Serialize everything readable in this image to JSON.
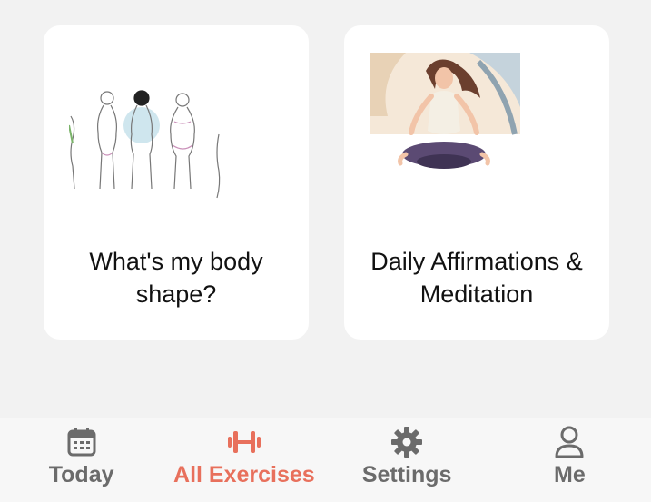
{
  "cards": [
    {
      "title": "What's my body shape?",
      "image": "body-shapes-illustration"
    },
    {
      "title": "Daily Affirmations & Meditation",
      "image": "meditation-illustration"
    }
  ],
  "tabbar": {
    "active": "all-exercises",
    "active_color": "#e8705c",
    "inactive_color": "#6b6b6b",
    "items": [
      {
        "label": "Today",
        "icon": "calendar-icon"
      },
      {
        "label": "All Exercises",
        "icon": "dumbbell-icon"
      },
      {
        "label": "Settings",
        "icon": "gear-icon"
      },
      {
        "label": "Me",
        "icon": "person-icon"
      }
    ]
  }
}
